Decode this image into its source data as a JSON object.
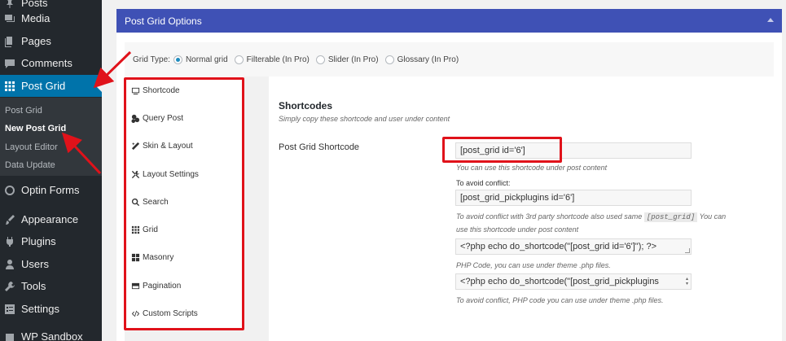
{
  "sidebar": {
    "items": [
      {
        "label": "Posts",
        "icon": "pin-icon"
      },
      {
        "label": "Media",
        "icon": "media-icon"
      },
      {
        "label": "Pages",
        "icon": "pages-icon"
      },
      {
        "label": "Comments",
        "icon": "comments-icon"
      },
      {
        "label": "Post Grid",
        "icon": "grid-icon"
      },
      {
        "label": "Optin Forms",
        "icon": "circle-icon"
      },
      {
        "label": "Appearance",
        "icon": "brush-icon"
      },
      {
        "label": "Plugins",
        "icon": "plug-icon"
      },
      {
        "label": "Users",
        "icon": "users-icon"
      },
      {
        "label": "Tools",
        "icon": "wrench-icon"
      },
      {
        "label": "Settings",
        "icon": "settings-icon"
      },
      {
        "label": "WP Sandbox",
        "icon": "sandbox-icon"
      }
    ],
    "submenu": [
      "Post Grid",
      "New Post Grid",
      "Layout Editor",
      "Data Update"
    ]
  },
  "panel": {
    "title": "Post Grid Options"
  },
  "grid_type": {
    "label": "Grid Type:",
    "options": [
      "Normal grid",
      "Filterable (In Pro)",
      "Slider (In Pro)",
      "Glossary (In Pro)"
    ],
    "selected": "Normal grid"
  },
  "tabs": [
    {
      "label": "Shortcode",
      "icon": "shortcode-icon"
    },
    {
      "label": "Query Post",
      "icon": "query-icon"
    },
    {
      "label": "Skin & Layout",
      "icon": "magic-wand-icon"
    },
    {
      "label": "Layout Settings",
      "icon": "tools-icon"
    },
    {
      "label": "Search",
      "icon": "search-icon"
    },
    {
      "label": "Grid",
      "icon": "grid-icon"
    },
    {
      "label": "Masonry",
      "icon": "masonry-icon"
    },
    {
      "label": "Pagination",
      "icon": "pagination-icon"
    },
    {
      "label": "Custom Scripts",
      "icon": "code-icon"
    }
  ],
  "content": {
    "title": "Shortcodes",
    "description": "Simply copy these shortcode and user under content",
    "shortcode_label": "Post Grid Shortcode",
    "shortcode_value": "[post_grid id='6']",
    "shortcode_hint": "You can use this shortcode under post content",
    "avoid_label": "To avoid conflict:",
    "avoid_value": "[post_grid_pickplugins id='6']",
    "avoid_hint_1": "To avoid conflict with 3rd party shortcode also used same",
    "avoid_hint_code": "[post_grid]",
    "avoid_hint_2": "You can",
    "avoid_hint_3": "use this shortcode under post content",
    "php_value": "<?php echo do_shortcode(\"[post_grid id='6']\"); ?>",
    "php_hint": "PHP Code, you can use under theme .php files.",
    "php2_value": "<?php echo do_shortcode(\"[post_grid_pickplugins",
    "php2_hint": "To avoid conflict, PHP code you can use under theme .php files."
  },
  "colors": {
    "admin_bar": "#23282d",
    "active_menu": "#0073aa",
    "panel_header": "#3f51b5",
    "annotation": "#e0121a"
  }
}
